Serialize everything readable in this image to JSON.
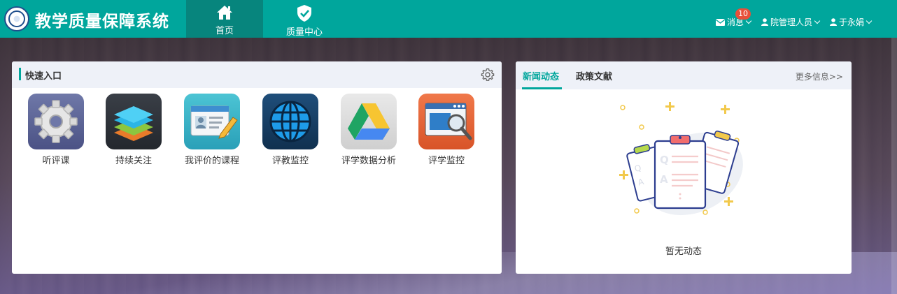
{
  "header": {
    "app_title": "教学质量保障系统",
    "nav": [
      {
        "label": "首页",
        "icon": "home-icon",
        "active": true
      },
      {
        "label": "质量中心",
        "icon": "shield-check-icon",
        "active": false
      }
    ],
    "messages_label": "消息",
    "messages_badge": "10",
    "role_label": "院管理人员",
    "user_label": "于永娟"
  },
  "quick_entry": {
    "title": "快速入口",
    "items": [
      {
        "label": "听评课",
        "icon": "gear-app-icon"
      },
      {
        "label": "持续关注",
        "icon": "layers-app-icon"
      },
      {
        "label": "我评价的课程",
        "icon": "id-card-pencil-icon"
      },
      {
        "label": "评教监控",
        "icon": "globe-app-icon"
      },
      {
        "label": "评学数据分析",
        "icon": "drive-triangle-icon"
      },
      {
        "label": "评学监控",
        "icon": "window-magnifier-icon"
      }
    ]
  },
  "news_panel": {
    "tabs": [
      "新闻动态",
      "政策文献"
    ],
    "active_tab": "新闻动态",
    "more_label": "更多信息>>",
    "empty_text": "暂无动态"
  },
  "colors": {
    "primary": "#00a69c",
    "primary_dark": "#07857d",
    "badge": "#e8503a"
  }
}
